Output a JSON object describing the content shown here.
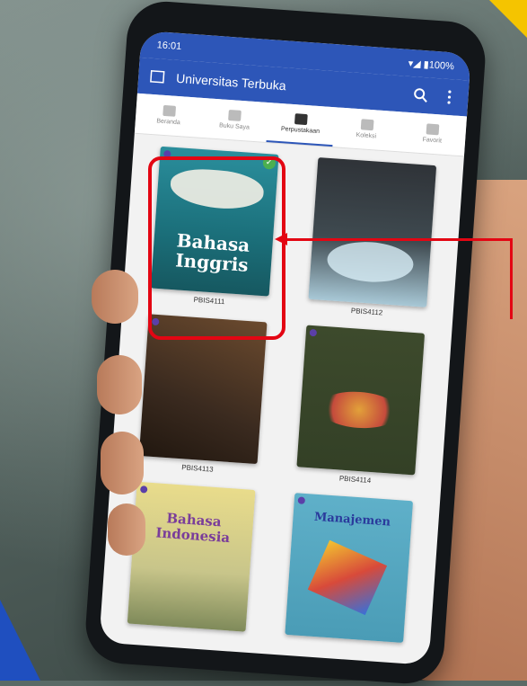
{
  "status_bar": {
    "time": "16:01",
    "indicators": "▾◢ ▮100%"
  },
  "app_bar": {
    "title": "Universitas Terbuka",
    "search_icon": "search-icon",
    "menu_icon": "more-vert-icon"
  },
  "tabs": [
    {
      "label": "Beranda",
      "icon": "list-icon"
    },
    {
      "label": "Buku Saya",
      "icon": "tablet-icon"
    },
    {
      "label": "Perpustakaan",
      "icon": "tablet-active-icon",
      "active": true
    },
    {
      "label": "Koleksi",
      "icon": "folder-icon"
    },
    {
      "label": "Favorit",
      "icon": "heart-icon"
    }
  ],
  "books": [
    {
      "cover_title": "Bahasa Inggris",
      "caption": "PBIS4111",
      "cover_color": "#1b6f7a",
      "selected": true
    },
    {
      "cover_title": "",
      "caption": "PBIS4112",
      "cover_color": "#2f3338"
    },
    {
      "cover_title": "",
      "caption": "PBIS4113",
      "cover_color": "#3a2a1f"
    },
    {
      "cover_title": "",
      "caption": "PBIS4114",
      "cover_color": "#3d4a2c"
    },
    {
      "cover_title": "Bahasa Indonesia",
      "caption": "",
      "cover_color": "#e9dc8b"
    },
    {
      "cover_title": "Manajemen",
      "caption": "",
      "cover_color": "#5fb0c9"
    }
  ],
  "colors": {
    "primary": "#2d56b8",
    "highlight": "#e30613",
    "check": "#4caf50"
  }
}
